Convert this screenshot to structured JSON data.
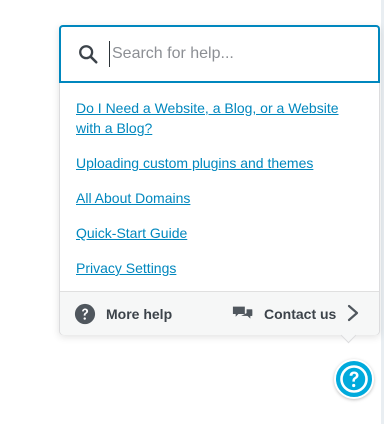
{
  "search": {
    "placeholder": "Search for help..."
  },
  "links": [
    {
      "label": "Do I Need a Website, a Blog, or a Website with a Blog?"
    },
    {
      "label": "Uploading custom plugins and themes"
    },
    {
      "label": "All About Domains"
    },
    {
      "label": "Quick-Start Guide"
    },
    {
      "label": "Privacy Settings"
    }
  ],
  "footer": {
    "more_help_label": "More help",
    "contact_us_label": "Contact us"
  },
  "icons": {
    "search": "search-icon",
    "more_help": "question-circle-icon",
    "contact_us": "chat-bubbles-icon",
    "chevron": "chevron-right-icon",
    "help_fab": "help-question-icon"
  },
  "colors": {
    "accent": "#0087be",
    "fab": "#00aadc",
    "footer_bg": "#f6f7f7",
    "text": "#3c434a"
  }
}
